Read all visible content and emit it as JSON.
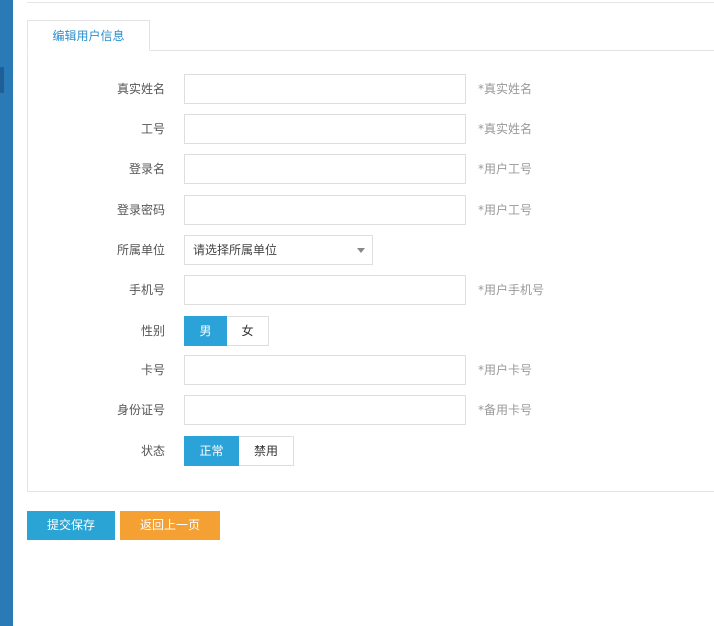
{
  "tab_label": "编辑用户信息",
  "fields": {
    "real_name": {
      "label": "真实姓名",
      "value": "",
      "hint": "*真实姓名"
    },
    "employee_no": {
      "label": "工号",
      "value": "",
      "hint": "*真实姓名"
    },
    "login_name": {
      "label": "登录名",
      "value": "",
      "hint": "*用户工号"
    },
    "login_password": {
      "label": "登录密码",
      "value": "",
      "hint": "*用户工号"
    },
    "unit": {
      "label": "所属单位",
      "selected": "请选择所属单位"
    },
    "phone": {
      "label": "手机号",
      "value": "",
      "hint": "*用户手机号"
    },
    "gender": {
      "label": "性别",
      "options": [
        "男",
        "女"
      ],
      "selected": "男"
    },
    "card_no": {
      "label": "卡号",
      "value": "",
      "hint": "*用户卡号"
    },
    "id_no": {
      "label": "身份证号",
      "value": "",
      "hint": "*备用卡号"
    },
    "status": {
      "label": "状态",
      "options": [
        "正常",
        "禁用"
      ],
      "selected": "正常"
    }
  },
  "buttons": {
    "submit": "提交保存",
    "back": "返回上一页"
  },
  "colors": {
    "primary": "#2ba2d8",
    "warning": "#f5a033",
    "sidebar": "#2a7ab8"
  }
}
